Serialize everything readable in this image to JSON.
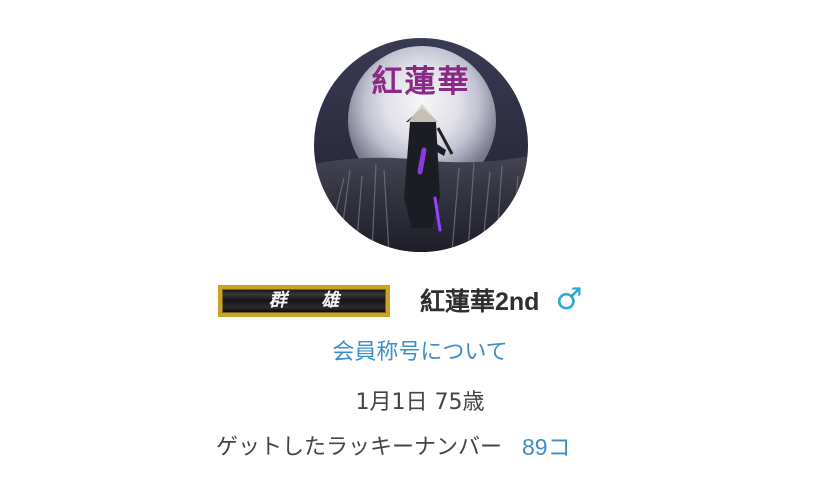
{
  "profile": {
    "avatar_title": "紅蓮華",
    "rank_badge": "群 雄",
    "name": "紅蓮華2nd",
    "gender_symbol": "♂",
    "rank_link": "会員称号について",
    "birthday_age": "1月1日 75歳",
    "lucky_label": "ゲットしたラッキーナンバー",
    "lucky_count": "89コ"
  },
  "colors": {
    "link": "#3c8fcb",
    "gender": "#2ca8d6",
    "badge_frame": "#c9a326"
  },
  "icons": {
    "gender": "male-icon"
  }
}
